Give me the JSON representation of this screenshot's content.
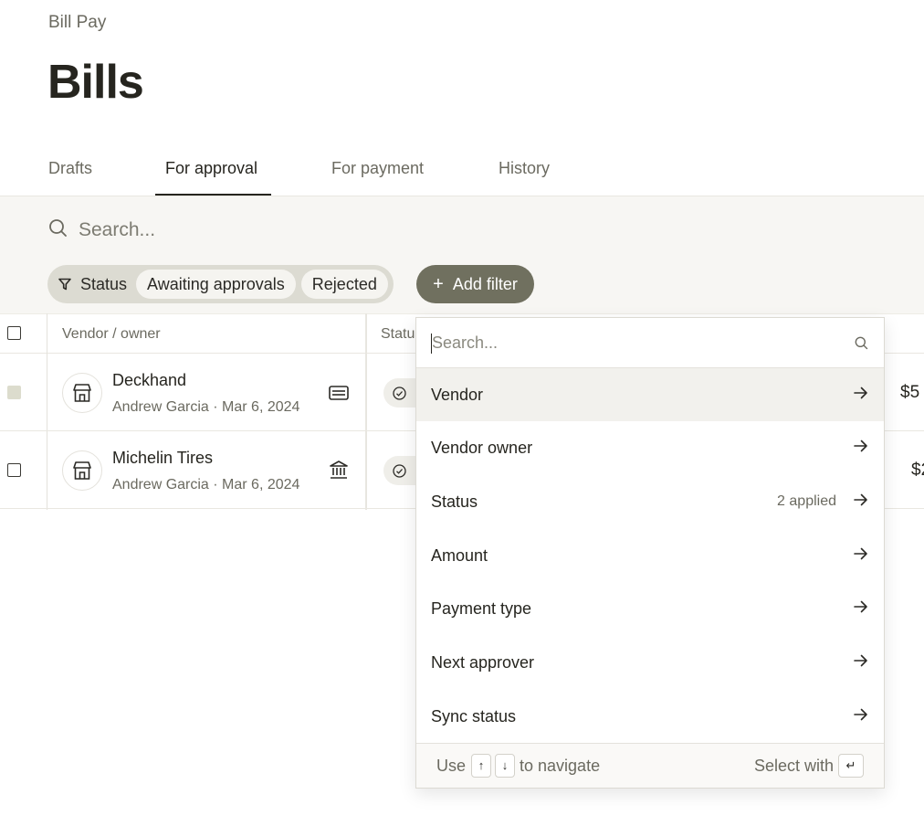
{
  "header": {
    "breadcrumb": "Bill Pay",
    "title": "Bills"
  },
  "tabs": [
    {
      "label": "Drafts",
      "active": false
    },
    {
      "label": "For approval",
      "active": true
    },
    {
      "label": "For payment",
      "active": false
    },
    {
      "label": "History",
      "active": false
    }
  ],
  "search": {
    "placeholder": "Search..."
  },
  "filters": {
    "status_label": "Status",
    "chips": [
      "Awaiting approvals",
      "Rejected"
    ],
    "add_filter_label": "Add filter"
  },
  "table": {
    "columns": [
      "Vendor / owner",
      "Status"
    ],
    "rows": [
      {
        "vendor": "Deckhand",
        "sub": "Andrew Garcia · Mar 6, 2024",
        "payment_icon": "card-icon",
        "amount": "$5"
      },
      {
        "vendor": "Michelin Tires",
        "sub": "Andrew Garcia · Mar 6, 2024",
        "payment_icon": "bank-icon",
        "amount": "$2"
      }
    ]
  },
  "dropdown": {
    "search_placeholder": "Search...",
    "items": [
      {
        "label": "Vendor",
        "badge": ""
      },
      {
        "label": "Vendor owner",
        "badge": ""
      },
      {
        "label": "Status",
        "badge": "2 applied"
      },
      {
        "label": "Amount",
        "badge": ""
      },
      {
        "label": "Payment type",
        "badge": ""
      },
      {
        "label": "Next approver",
        "badge": ""
      },
      {
        "label": "Sync status",
        "badge": ""
      }
    ],
    "footer": {
      "use": "Use",
      "up_key": "↑",
      "down_key": "↓",
      "navigate": "to navigate",
      "select_with": "Select with",
      "enter_key": "↵"
    }
  },
  "colors": {
    "accent_button": "#70705f",
    "filter_group_bg": "#dcdbd2",
    "toolbar_bg": "#f7f6f3",
    "text_primary": "#26251f"
  }
}
